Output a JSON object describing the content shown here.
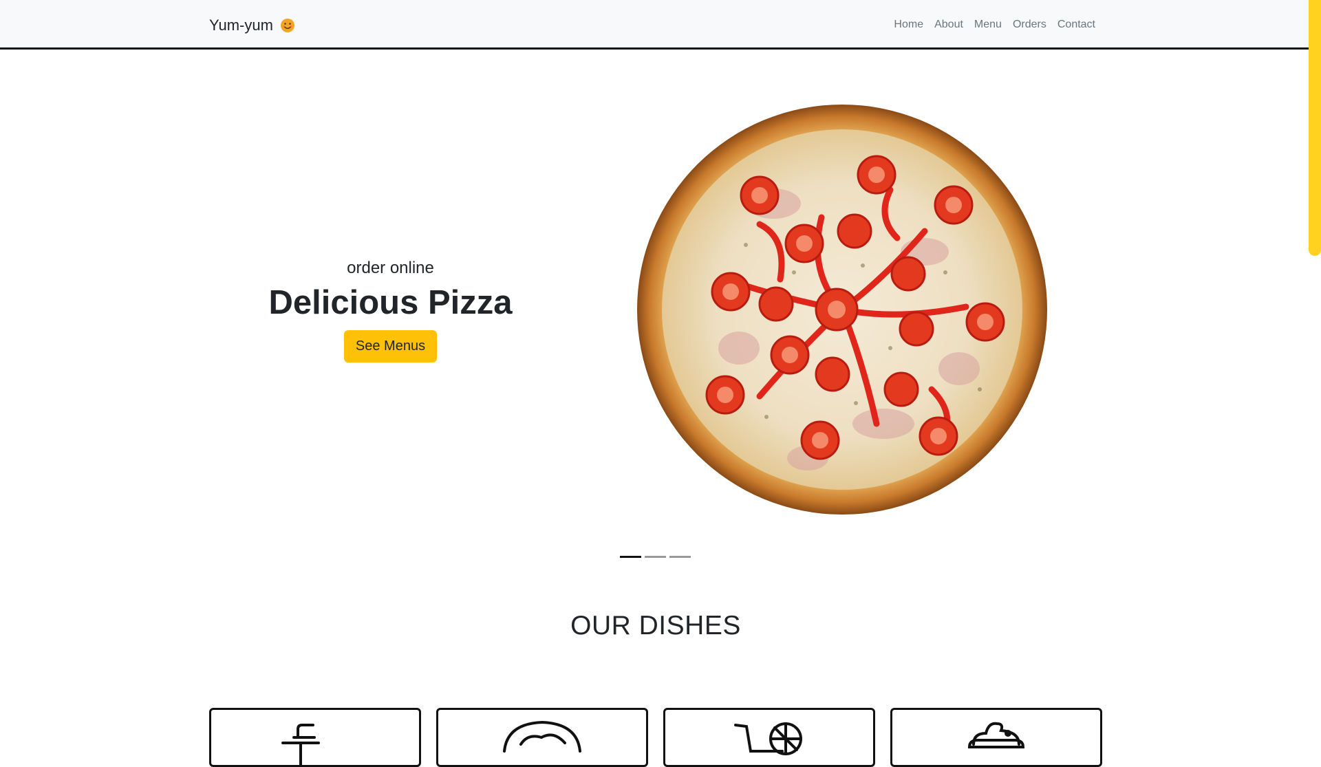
{
  "navbar": {
    "brand": "Yum-yum",
    "brand_icon": "smiley-emoji-icon",
    "links": [
      "Home",
      "About",
      "Menu",
      "Orders",
      "Contact"
    ]
  },
  "hero": {
    "kicker": "order online",
    "title": "Delicious Pizza",
    "button": "See Menus",
    "image": "pizza-image",
    "slides": 3,
    "active_slide": 1
  },
  "dishes": {
    "title": "OUR DISHES",
    "cards": [
      {
        "icon": "drink-cup-icon"
      },
      {
        "icon": "salad-bowl-icon"
      },
      {
        "icon": "juice-cart-icon"
      },
      {
        "icon": "dessert-icon"
      }
    ]
  },
  "colors": {
    "accent": "#ffc107",
    "scroll_thumb": "#ffd21f",
    "nav_bg": "#f8f9fa",
    "text": "#212529"
  }
}
